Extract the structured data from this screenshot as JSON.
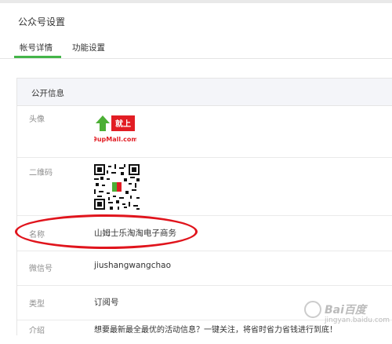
{
  "header": {
    "title": "公众号设置"
  },
  "tabs": [
    {
      "label": "帐号详情",
      "active": true
    },
    {
      "label": "功能设置",
      "active": false
    }
  ],
  "section": {
    "title": "公开信息",
    "rows": {
      "avatar_label": "头像",
      "avatar_logo_top": "就上",
      "avatar_logo_bottom": "9upMall.com",
      "qrcode_label": "二维码",
      "name_label": "名称",
      "name_value": "山姆士乐淘淘电子商务",
      "wechat_label": "微信号",
      "wechat_value": "jiushangwangchao",
      "type_label": "类型",
      "type_value": "订阅号",
      "intro_label": "介绍",
      "intro_value": "想要最新最全最优的活动信息？一键关注，将省时省力省钱进行到底！"
    }
  },
  "watermark": {
    "brand": "Bai百度",
    "sub": "jingyan.baidu.com"
  },
  "colors": {
    "accent": "#44b549",
    "highlight": "#e0141c",
    "header_bg": "#f4f5f9"
  }
}
